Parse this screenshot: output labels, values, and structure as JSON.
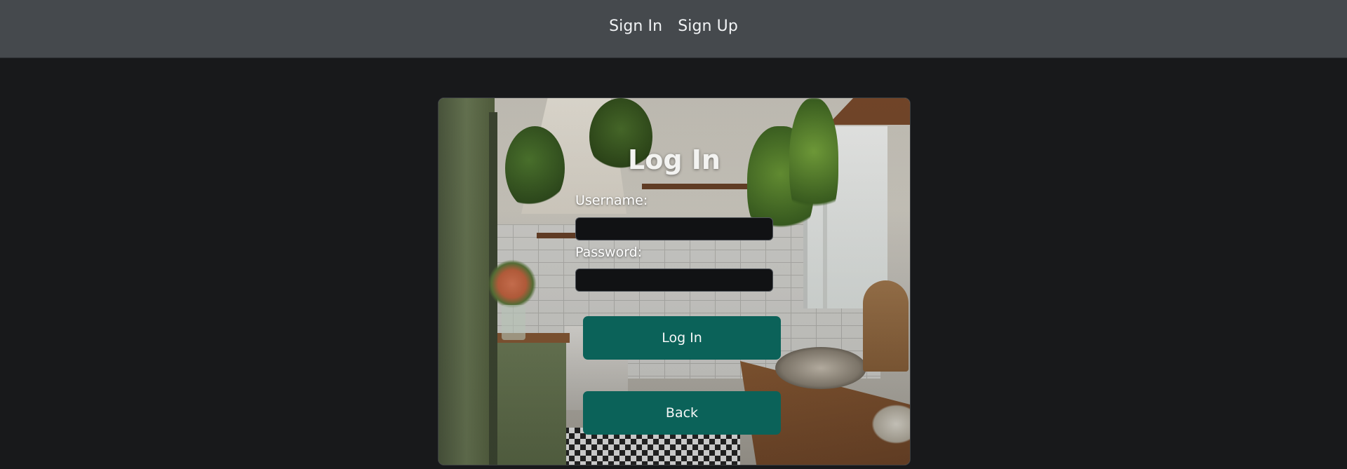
{
  "nav": {
    "sign_in": "Sign In",
    "sign_up": "Sign Up"
  },
  "login_form": {
    "title": "Log In",
    "username_label": "Username:",
    "username_value": "",
    "password_label": "Password:",
    "password_value": "",
    "login_button": "Log In",
    "back_button": "Back"
  },
  "colors": {
    "navbar_bg": "#45494d",
    "page_bg": "#18191b",
    "button_bg": "#0b6259",
    "input_bg": "#111214"
  }
}
